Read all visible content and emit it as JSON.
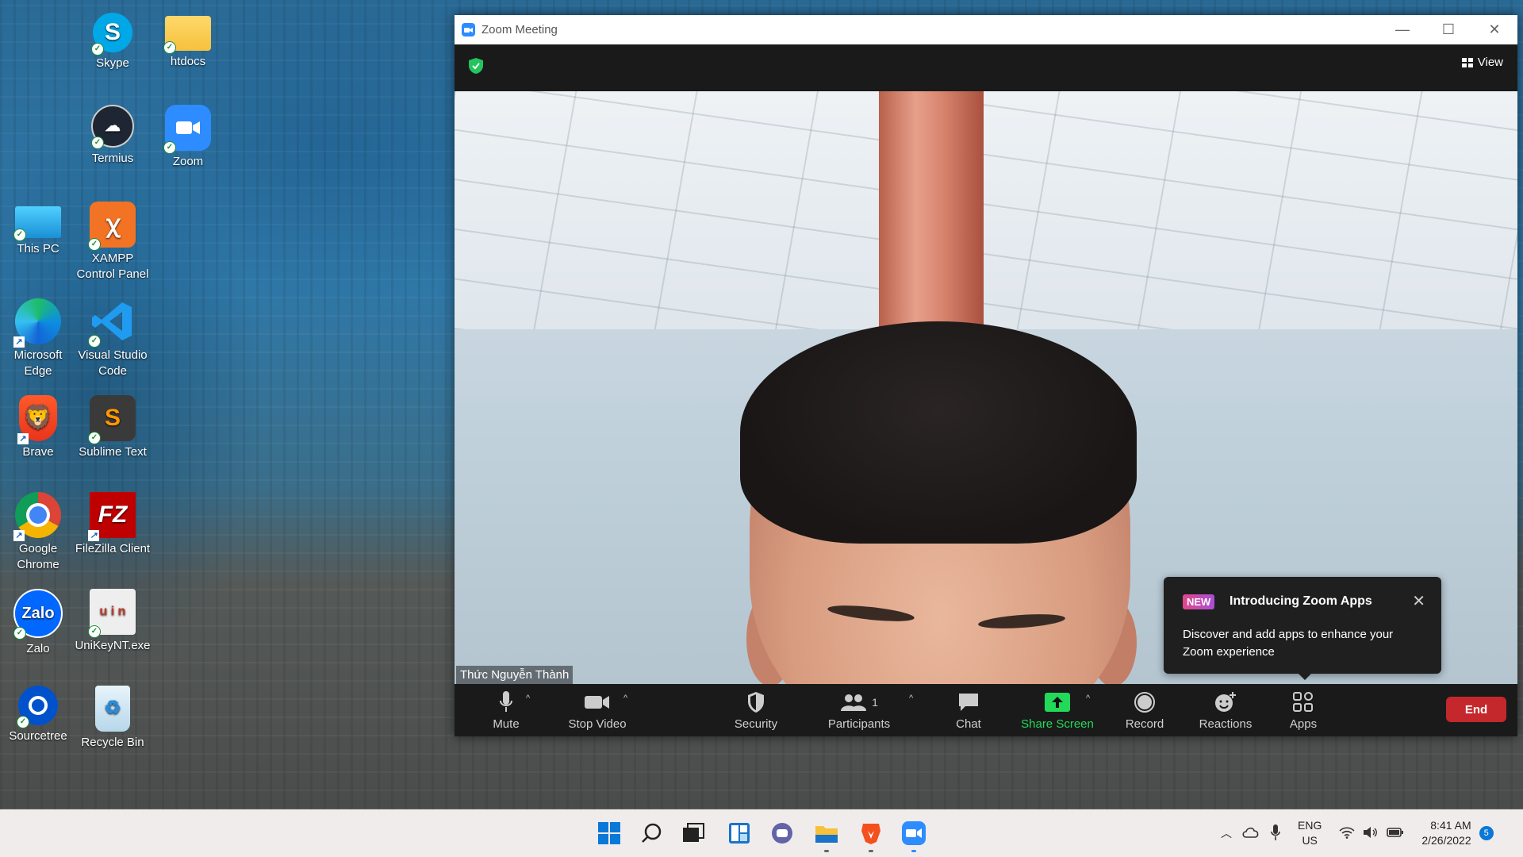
{
  "desktop": {
    "icons": [
      {
        "label": "Skype"
      },
      {
        "label": "htdocs"
      },
      {
        "label": "Termius"
      },
      {
        "label": "Zoom"
      },
      {
        "label": "This PC"
      },
      {
        "label": "XAMPP Control Panel"
      },
      {
        "label": "Microsoft Edge"
      },
      {
        "label": "Visual Studio Code"
      },
      {
        "label": "Brave"
      },
      {
        "label": "Sublime Text"
      },
      {
        "label": "Google Chrome"
      },
      {
        "label": "FileZilla Client"
      },
      {
        "label": "Zalo"
      },
      {
        "label": "UniKeyNT.exe"
      },
      {
        "label": "Sourcetree"
      },
      {
        "label": "Recycle Bin"
      }
    ]
  },
  "zoom_window": {
    "title": "Zoom Meeting",
    "view_label": "View",
    "participant_name": "Thức Nguyễn Thành",
    "popup": {
      "badge": "NEW",
      "title": "Introducing Zoom Apps",
      "body": "Discover and add apps to enhance your Zoom experience"
    },
    "toolbar": {
      "mute": "Mute",
      "stop_video": "Stop Video",
      "security": "Security",
      "participants": "Participants",
      "participants_count": "1",
      "chat": "Chat",
      "share_screen": "Share Screen",
      "record": "Record",
      "reactions": "Reactions",
      "apps": "Apps",
      "end": "End"
    },
    "colors": {
      "accent": "#2d8cff",
      "share_green": "#23d959",
      "end_red": "#c4282c"
    }
  },
  "taskbar": {
    "language": "ENG",
    "region": "US",
    "time": "8:41 AM",
    "date": "2/26/2022",
    "notification_count": "5"
  }
}
